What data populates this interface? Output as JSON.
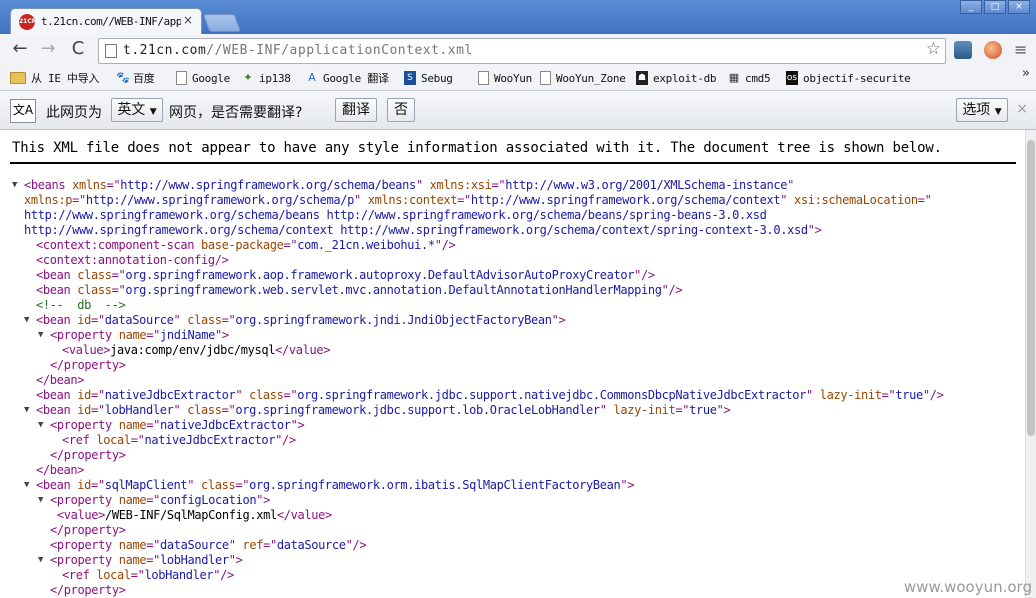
{
  "window": {
    "tab_title": "t.21cn.com//WEB-INF/app",
    "favicon_text": "21CN",
    "tab_close": "×",
    "controls": [
      "_",
      "□",
      "×"
    ]
  },
  "toolbar": {
    "url_host": "t.21cn.com",
    "url_path": "//WEB-INF/applicationContext.xml",
    "back": "←",
    "forward": "→",
    "reload": "C",
    "star": "☆",
    "menu": "≡"
  },
  "bookmarks": [
    {
      "label": "从 IE 中导入",
      "icon": "folder-icon"
    },
    {
      "label": "百度",
      "icon": "baidu-icon"
    },
    {
      "label": "Google",
      "icon": "page-icon"
    },
    {
      "label": "ip138",
      "icon": "ip138-icon"
    },
    {
      "label": "Google 翻译",
      "icon": "translate-icon"
    },
    {
      "label": "Sebug",
      "icon": "sebug-icon"
    },
    {
      "label": "WooYun",
      "icon": "page-icon"
    },
    {
      "label": "WooYun_Zone",
      "icon": "page-icon"
    },
    {
      "label": "exploit-db",
      "icon": "exploitdb-icon"
    },
    {
      "label": "cmd5",
      "icon": "cmd5-icon"
    },
    {
      "label": "objectif-securite",
      "icon": "objectif-icon"
    }
  ],
  "bookmarks_more": "»",
  "translate": {
    "icon_text": "文A",
    "prefix": "此网页为",
    "language": "英文",
    "suffix": "网页，是否需要翻译?",
    "translate_button": "翻译",
    "no_button": "否",
    "options_button": "选项",
    "close": "×"
  },
  "content": {
    "notice": "This XML file does not appear to have any style information associated with it. The document tree is shown below.",
    "toggle_glyph": "▼",
    "lines": [
      {
        "toggle": true,
        "indent": 0,
        "parts": [
          [
            "tg",
            "<beans "
          ],
          [
            "an",
            "xmlns"
          ],
          [
            "tg",
            "=\""
          ],
          [
            "av",
            "http://www.springframework.org/schema/beans"
          ],
          [
            "tg",
            "\" "
          ],
          [
            "an",
            "xmlns:xsi"
          ],
          [
            "tg",
            "=\""
          ],
          [
            "av",
            "http://www.w3.org/2001/XMLSchema-instance"
          ],
          [
            "tg",
            "\""
          ]
        ]
      },
      {
        "toggle": false,
        "indent": 0,
        "parts": [
          [
            "an",
            "xmlns:p"
          ],
          [
            "tg",
            "=\""
          ],
          [
            "av",
            "http://www.springframework.org/schema/p"
          ],
          [
            "tg",
            "\" "
          ],
          [
            "an",
            "xmlns:context"
          ],
          [
            "tg",
            "=\""
          ],
          [
            "av",
            "http://www.springframework.org/schema/context"
          ],
          [
            "tg",
            "\" "
          ],
          [
            "an",
            "xsi:schemaLocation"
          ],
          [
            "tg",
            "=\""
          ]
        ]
      },
      {
        "toggle": false,
        "indent": 0,
        "parts": [
          [
            "av",
            "http://www.springframework.org/schema/beans http://www.springframework.org/schema/beans/spring-beans-3.0.xsd"
          ]
        ]
      },
      {
        "toggle": false,
        "indent": 0,
        "parts": [
          [
            "av",
            "http://www.springframework.org/schema/context http://www.springframework.org/schema/context/spring-context-3.0.xsd"
          ],
          [
            "tg",
            "\">"
          ]
        ]
      },
      {
        "toggle": false,
        "indent": 1,
        "parts": [
          [
            "tg",
            "<context:component-scan "
          ],
          [
            "an",
            "base-package"
          ],
          [
            "tg",
            "=\""
          ],
          [
            "av",
            "com._21cn.weibohui.*"
          ],
          [
            "tg",
            "\"/>"
          ]
        ]
      },
      {
        "toggle": false,
        "indent": 1,
        "parts": [
          [
            "tg",
            "<context:annotation-config/>"
          ]
        ]
      },
      {
        "toggle": false,
        "indent": 1,
        "parts": [
          [
            "tg",
            "<bean "
          ],
          [
            "an",
            "class"
          ],
          [
            "tg",
            "=\""
          ],
          [
            "av",
            "org.springframework.aop.framework.autoproxy.DefaultAdvisorAutoProxyCreator"
          ],
          [
            "tg",
            "\"/>"
          ]
        ]
      },
      {
        "toggle": false,
        "indent": 1,
        "parts": [
          [
            "tg",
            "<bean "
          ],
          [
            "an",
            "class"
          ],
          [
            "tg",
            "=\""
          ],
          [
            "av",
            "org.springframework.web.servlet.mvc.annotation.DefaultAnnotationHandlerMapping"
          ],
          [
            "tg",
            "\"/>"
          ]
        ]
      },
      {
        "toggle": false,
        "indent": 1,
        "parts": [
          [
            "cm",
            "<!--  db  -->"
          ]
        ]
      },
      {
        "toggle": true,
        "indent": 1,
        "parts": [
          [
            "tg",
            "<bean "
          ],
          [
            "an",
            "id"
          ],
          [
            "tg",
            "=\""
          ],
          [
            "av",
            "dataSource"
          ],
          [
            "tg",
            "\" "
          ],
          [
            "an",
            "class"
          ],
          [
            "tg",
            "=\""
          ],
          [
            "av",
            "org.springframework.jndi.JndiObjectFactoryBean"
          ],
          [
            "tg",
            "\">"
          ]
        ]
      },
      {
        "toggle": true,
        "indent": 2,
        "parts": [
          [
            "tg",
            "<property "
          ],
          [
            "an",
            "name"
          ],
          [
            "tg",
            "=\""
          ],
          [
            "av",
            "jndiName"
          ],
          [
            "tg",
            "\">"
          ]
        ]
      },
      {
        "toggle": false,
        "indent": 3,
        "parts": [
          [
            "tg",
            "<value>"
          ],
          [
            "tx",
            "java:comp/env/jdbc/mysql"
          ],
          [
            "tg",
            "</value>"
          ]
        ]
      },
      {
        "toggle": false,
        "indent": 2,
        "parts": [
          [
            "tg",
            "</property>"
          ]
        ]
      },
      {
        "toggle": false,
        "indent": 1,
        "parts": [
          [
            "tg",
            "</bean>"
          ]
        ]
      },
      {
        "toggle": false,
        "indent": 1,
        "parts": [
          [
            "tg",
            "<bean "
          ],
          [
            "an",
            "id"
          ],
          [
            "tg",
            "=\""
          ],
          [
            "av",
            "nativeJdbcExtractor"
          ],
          [
            "tg",
            "\" "
          ],
          [
            "an",
            "class"
          ],
          [
            "tg",
            "=\""
          ],
          [
            "av",
            "org.springframework.jdbc.support.nativejdbc.CommonsDbcpNativeJdbcExtractor"
          ],
          [
            "tg",
            "\" "
          ],
          [
            "an",
            "lazy-init"
          ],
          [
            "tg",
            "=\""
          ],
          [
            "av",
            "true"
          ],
          [
            "tg",
            "\"/>"
          ]
        ]
      },
      {
        "toggle": true,
        "indent": 1,
        "parts": [
          [
            "tg",
            "<bean "
          ],
          [
            "an",
            "id"
          ],
          [
            "tg",
            "=\""
          ],
          [
            "av",
            "lobHandler"
          ],
          [
            "tg",
            "\" "
          ],
          [
            "an",
            "class"
          ],
          [
            "tg",
            "=\""
          ],
          [
            "av",
            "org.springframework.jdbc.support.lob.OracleLobHandler"
          ],
          [
            "tg",
            "\" "
          ],
          [
            "an",
            "lazy-init"
          ],
          [
            "tg",
            "=\""
          ],
          [
            "av",
            "true"
          ],
          [
            "tg",
            "\">"
          ]
        ]
      },
      {
        "toggle": true,
        "indent": 2,
        "parts": [
          [
            "tg",
            "<property "
          ],
          [
            "an",
            "name"
          ],
          [
            "tg",
            "=\""
          ],
          [
            "av",
            "nativeJdbcExtractor"
          ],
          [
            "tg",
            "\">"
          ]
        ]
      },
      {
        "toggle": false,
        "indent": 3,
        "parts": [
          [
            "tg",
            "<ref "
          ],
          [
            "an",
            "local"
          ],
          [
            "tg",
            "=\""
          ],
          [
            "av",
            "nativeJdbcExtractor"
          ],
          [
            "tg",
            "\"/>"
          ]
        ]
      },
      {
        "toggle": false,
        "indent": 2,
        "parts": [
          [
            "tg",
            "</property>"
          ]
        ]
      },
      {
        "toggle": false,
        "indent": 1,
        "parts": [
          [
            "tg",
            "</bean>"
          ]
        ]
      },
      {
        "toggle": true,
        "indent": 1,
        "parts": [
          [
            "tg",
            "<bean "
          ],
          [
            "an",
            "id"
          ],
          [
            "tg",
            "=\""
          ],
          [
            "av",
            "sqlMapClient"
          ],
          [
            "tg",
            "\" "
          ],
          [
            "an",
            "class"
          ],
          [
            "tg",
            "=\""
          ],
          [
            "av",
            "org.springframework.orm.ibatis.SqlMapClientFactoryBean"
          ],
          [
            "tg",
            "\">"
          ]
        ]
      },
      {
        "toggle": true,
        "indent": 2,
        "parts": [
          [
            "tg",
            "<property "
          ],
          [
            "an",
            "name"
          ],
          [
            "tg",
            "=\""
          ],
          [
            "av",
            "configLocation"
          ],
          [
            "tg",
            "\">"
          ]
        ]
      },
      {
        "toggle": false,
        "indent": 2,
        "parts": [
          [
            "tg",
            " <value>"
          ],
          [
            "tx",
            "/WEB-INF/SqlMapConfig.xml"
          ],
          [
            "tg",
            "</value>"
          ]
        ]
      },
      {
        "toggle": false,
        "indent": 2,
        "parts": [
          [
            "tg",
            "</property>"
          ]
        ]
      },
      {
        "toggle": false,
        "indent": 2,
        "parts": [
          [
            "tg",
            "<property "
          ],
          [
            "an",
            "name"
          ],
          [
            "tg",
            "=\""
          ],
          [
            "av",
            "dataSource"
          ],
          [
            "tg",
            "\" "
          ],
          [
            "an",
            "ref"
          ],
          [
            "tg",
            "=\""
          ],
          [
            "av",
            "dataSource"
          ],
          [
            "tg",
            "\"/>"
          ]
        ]
      },
      {
        "toggle": true,
        "indent": 2,
        "parts": [
          [
            "tg",
            "<property "
          ],
          [
            "an",
            "name"
          ],
          [
            "tg",
            "=\""
          ],
          [
            "av",
            "lobHandler"
          ],
          [
            "tg",
            "\">"
          ]
        ]
      },
      {
        "toggle": false,
        "indent": 3,
        "parts": [
          [
            "tg",
            "<ref "
          ],
          [
            "an",
            "local"
          ],
          [
            "tg",
            "=\""
          ],
          [
            "av",
            "lobHandler"
          ],
          [
            "tg",
            "\"/>"
          ]
        ]
      },
      {
        "toggle": false,
        "indent": 2,
        "parts": [
          [
            "tg",
            "</property>"
          ]
        ]
      }
    ]
  },
  "watermark": "www.wooyun.org"
}
